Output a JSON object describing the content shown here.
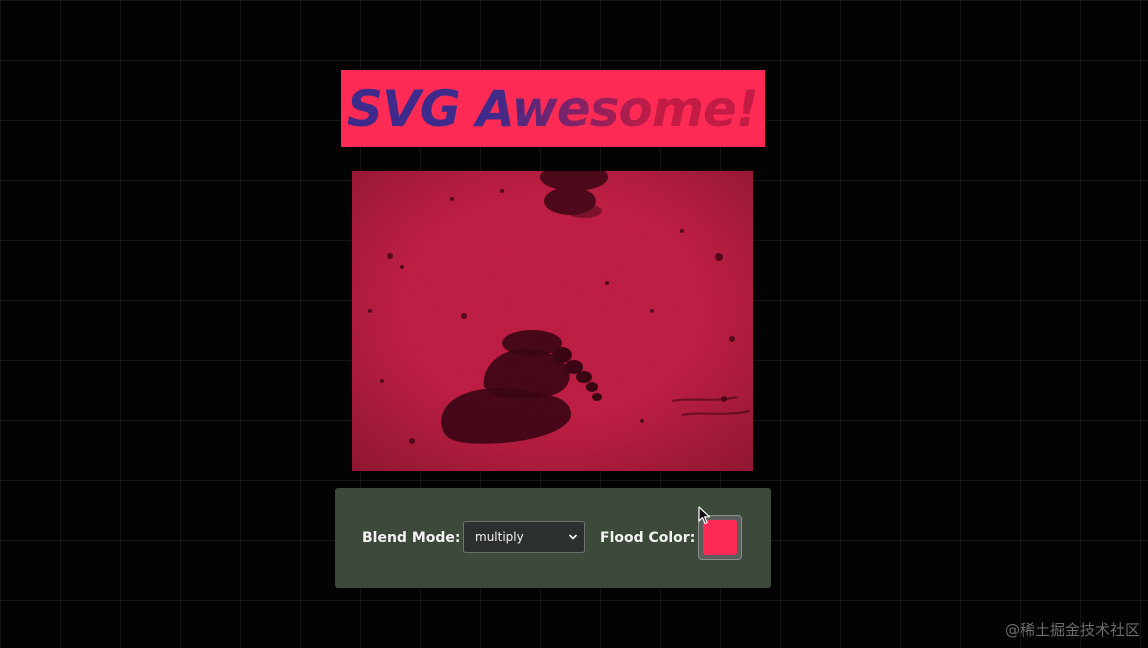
{
  "title": {
    "text": "SVG Awesome!",
    "banner_color": "#ff2b55",
    "gradient_start": "#3d2a8a",
    "gradient_end": "#c21b44"
  },
  "photo": {
    "description": "footprints-in-sand",
    "tint_color": "#c81a3e"
  },
  "controls": {
    "blend_mode_label": "Blend Mode:",
    "blend_mode_value": "multiply",
    "flood_color_label": "Flood Color:",
    "flood_color_value": "#ff2b55",
    "panel_color": "#3d4a3b"
  },
  "watermark": "@稀土掘金技术社区"
}
